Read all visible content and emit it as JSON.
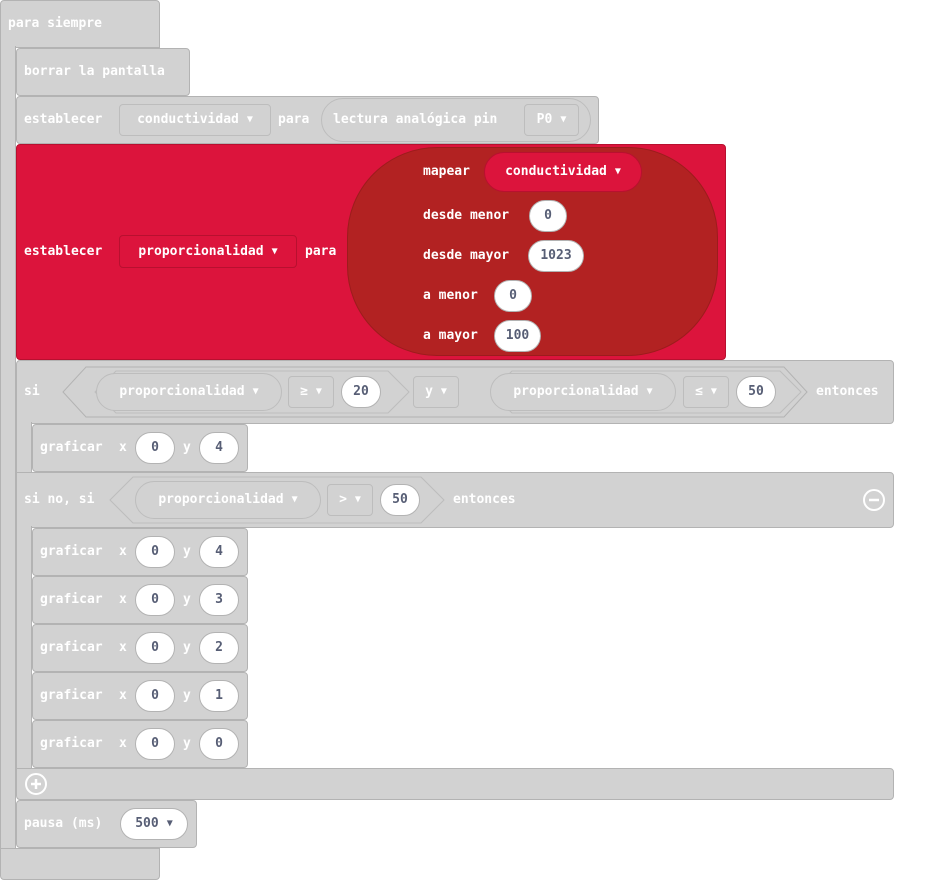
{
  "forever": {
    "label": "para siempre"
  },
  "clear": {
    "label": "borrar la pantalla"
  },
  "set1": {
    "label": "establecer",
    "variable": "conductividad",
    "to": "para",
    "reporter": "lectura analógica pin",
    "pin": "P0"
  },
  "set2": {
    "label": "establecer",
    "variable": "proporcionalidad",
    "to": "para",
    "map": {
      "label": "mapear",
      "variable": "conductividad",
      "from_low_label": "desde menor",
      "from_low": "0",
      "from_high_label": "desde mayor",
      "from_high": "1023",
      "to_low_label": "a menor",
      "to_low": "0",
      "to_high_label": "a mayor",
      "to_high": "100"
    }
  },
  "if_block": {
    "if_label": "si",
    "then_label": "entonces",
    "cond1": {
      "variable": "proporcionalidad",
      "op": "≥",
      "value": "20"
    },
    "logic": "y",
    "cond2": {
      "variable": "proporcionalidad",
      "op": "≤",
      "value": "50"
    },
    "plot1": {
      "label": "graficar",
      "x_label": "x",
      "x": "0",
      "y_label": "y",
      "y": "4"
    },
    "else_if_label": "si no, si",
    "cond3": {
      "variable": "proporcionalidad",
      "op": ">",
      "value": "50"
    },
    "plots": [
      {
        "label": "graficar",
        "x_label": "x",
        "x": "0",
        "y_label": "y",
        "y": "4"
      },
      {
        "label": "graficar",
        "x_label": "x",
        "x": "0",
        "y_label": "y",
        "y": "3"
      },
      {
        "label": "graficar",
        "x_label": "x",
        "x": "0",
        "y_label": "y",
        "y": "2"
      },
      {
        "label": "graficar",
        "x_label": "x",
        "x": "0",
        "y_label": "y",
        "y": "1"
      },
      {
        "label": "graficar",
        "x_label": "x",
        "x": "0",
        "y_label": "y",
        "y": "0"
      }
    ],
    "remove_icon": "minus-circle-icon",
    "add_icon": "plus-circle-icon"
  },
  "pause": {
    "label": "pausa (ms)",
    "value": "500"
  },
  "colors": {
    "block_gray": "#d2d2d2",
    "variables_red": "#dc143c",
    "map_dark_red": "#b22222",
    "value_text": "#575e75"
  }
}
